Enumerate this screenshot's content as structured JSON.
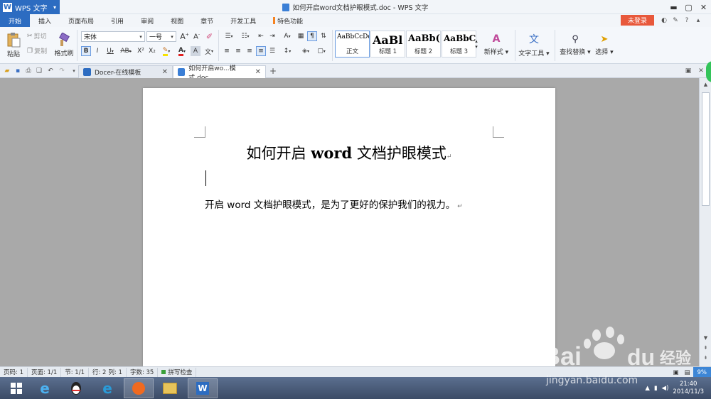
{
  "app": {
    "button_label": "WPS 文字",
    "window_title": "如何开启word文档护眼模式.doc - WPS 文字"
  },
  "menu": {
    "tabs": [
      "开始",
      "插入",
      "页面布局",
      "引用",
      "审阅",
      "视图",
      "章节",
      "开发工具",
      "特色功能"
    ],
    "login_label": "未登录"
  },
  "ribbon": {
    "paste_label": "粘贴",
    "cut_label": "剪切",
    "copy_label": "复制",
    "format_painter_label": "格式刷",
    "font_name": "宋体",
    "font_size": "一号",
    "bold": "B",
    "italic": "I",
    "underline": "U",
    "strikethrough": "AB",
    "superscript": "X²",
    "subscript": "X₂",
    "styles": [
      {
        "preview": "AaBbCcDd",
        "name": "正文"
      },
      {
        "preview": "AaBl",
        "name": "标题 1"
      },
      {
        "preview": "AaBb(",
        "name": "标题 2"
      },
      {
        "preview": "AaBbC",
        "name": "标题 3"
      }
    ],
    "new_style_label": "新样式",
    "text_tools_label": "文字工具",
    "find_replace_label": "查找替换",
    "select_label": "选择"
  },
  "doc_tabs": [
    {
      "label": "Docer-在线模板",
      "icon": "docer-icon"
    },
    {
      "label": "如何开启wo...模式.doc",
      "icon": "doc-icon"
    }
  ],
  "document": {
    "title_pre": "如何开启 ",
    "title_word": "word",
    "title_post": " 文档护眼模式",
    "body": "开启 word 文档护眼模式，是为了更好的保护我们的视力。"
  },
  "status": {
    "page_code": "页码: 1",
    "pages": "页面: 1/1",
    "section": "节: 1/1",
    "row": "行: 2",
    "col": "列: 1",
    "word_count": "字数: 35",
    "spell_check": "拼写检查",
    "zoom": "9%"
  },
  "taskbar": {
    "time": "21:40",
    "date": "2014/11/3"
  },
  "watermark": {
    "brand": "Bai",
    "brand2": "du",
    "cn": "经验",
    "url": "jingyan.baidu.com"
  },
  "colors": {
    "accent": "#2c6cc1",
    "login": "#e8583b",
    "workspace": "#a9a9a9"
  }
}
